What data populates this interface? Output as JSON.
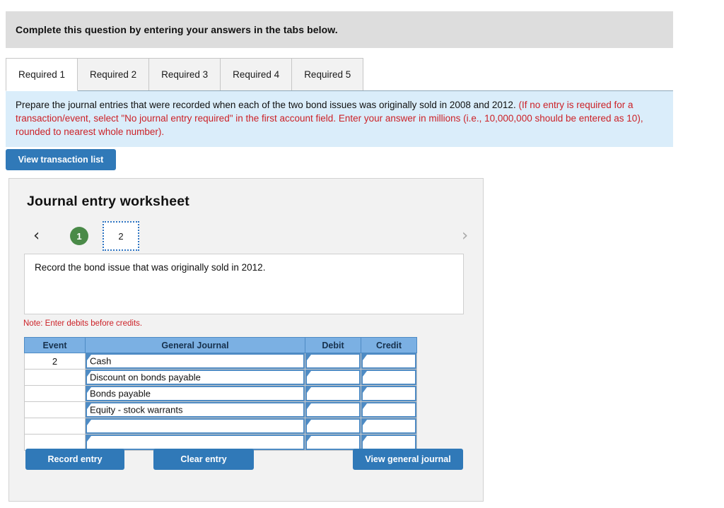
{
  "banner": {
    "text": "Complete this question by entering your answers in the tabs below."
  },
  "tabs": [
    {
      "label": "Required 1",
      "active": true
    },
    {
      "label": "Required 2",
      "active": false
    },
    {
      "label": "Required 3",
      "active": false
    },
    {
      "label": "Required 4",
      "active": false
    },
    {
      "label": "Required 5",
      "active": false
    }
  ],
  "instructions": {
    "black_text": "Prepare the journal entries that were recorded when each of the two bond issues was originally sold in 2008 and 2012.",
    "red_text": "(If no entry is required for a transaction/event, select \"No journal entry required\" in the first account field. Enter your answer in millions (i.e., 10,000,000 should be entered as 10), rounded to nearest whole number)."
  },
  "toolbar": {
    "view_transaction_list_label": "View transaction list"
  },
  "worksheet": {
    "title": "Journal entry worksheet",
    "pager": {
      "prev_icon": "chevron-left-icon",
      "prev_glyph": "‹",
      "next_icon": "chevron-right-icon",
      "next_glyph": "›",
      "steps": [
        {
          "label": "1",
          "state": "done"
        },
        {
          "label": "2",
          "state": "current"
        }
      ]
    },
    "description": "Record the bond issue that was originally sold in 2012.",
    "note": "Note: Enter debits before credits.",
    "table": {
      "headers": {
        "event": "Event",
        "general_journal": "General Journal",
        "debit": "Debit",
        "credit": "Credit"
      },
      "rows": [
        {
          "event": "2",
          "account": "Cash",
          "debit": "",
          "credit": ""
        },
        {
          "event": "",
          "account": "Discount on bonds payable",
          "debit": "",
          "credit": ""
        },
        {
          "event": "",
          "account": "Bonds payable",
          "debit": "",
          "credit": ""
        },
        {
          "event": "",
          "account": "Equity - stock warrants",
          "debit": "",
          "credit": ""
        },
        {
          "event": "",
          "account": "",
          "debit": "",
          "credit": ""
        },
        {
          "event": "",
          "account": "",
          "debit": "",
          "credit": ""
        }
      ]
    },
    "actions": {
      "record_entry_label": "Record entry",
      "clear_entry_label": "Clear entry",
      "view_general_journal_label": "View general journal"
    }
  },
  "colors": {
    "banner_bg": "#dddddd",
    "instruction_bg": "#daedfa",
    "instruction_red": "#cc2127",
    "button_blue": "#3079b8",
    "table_header_blue": "#7bb0e3",
    "cell_border_blue": "#4e8bc4",
    "step_done_green": "#4a8a48",
    "step_current_border": "#2e75c3",
    "panel_bg": "#f2f2f2"
  }
}
